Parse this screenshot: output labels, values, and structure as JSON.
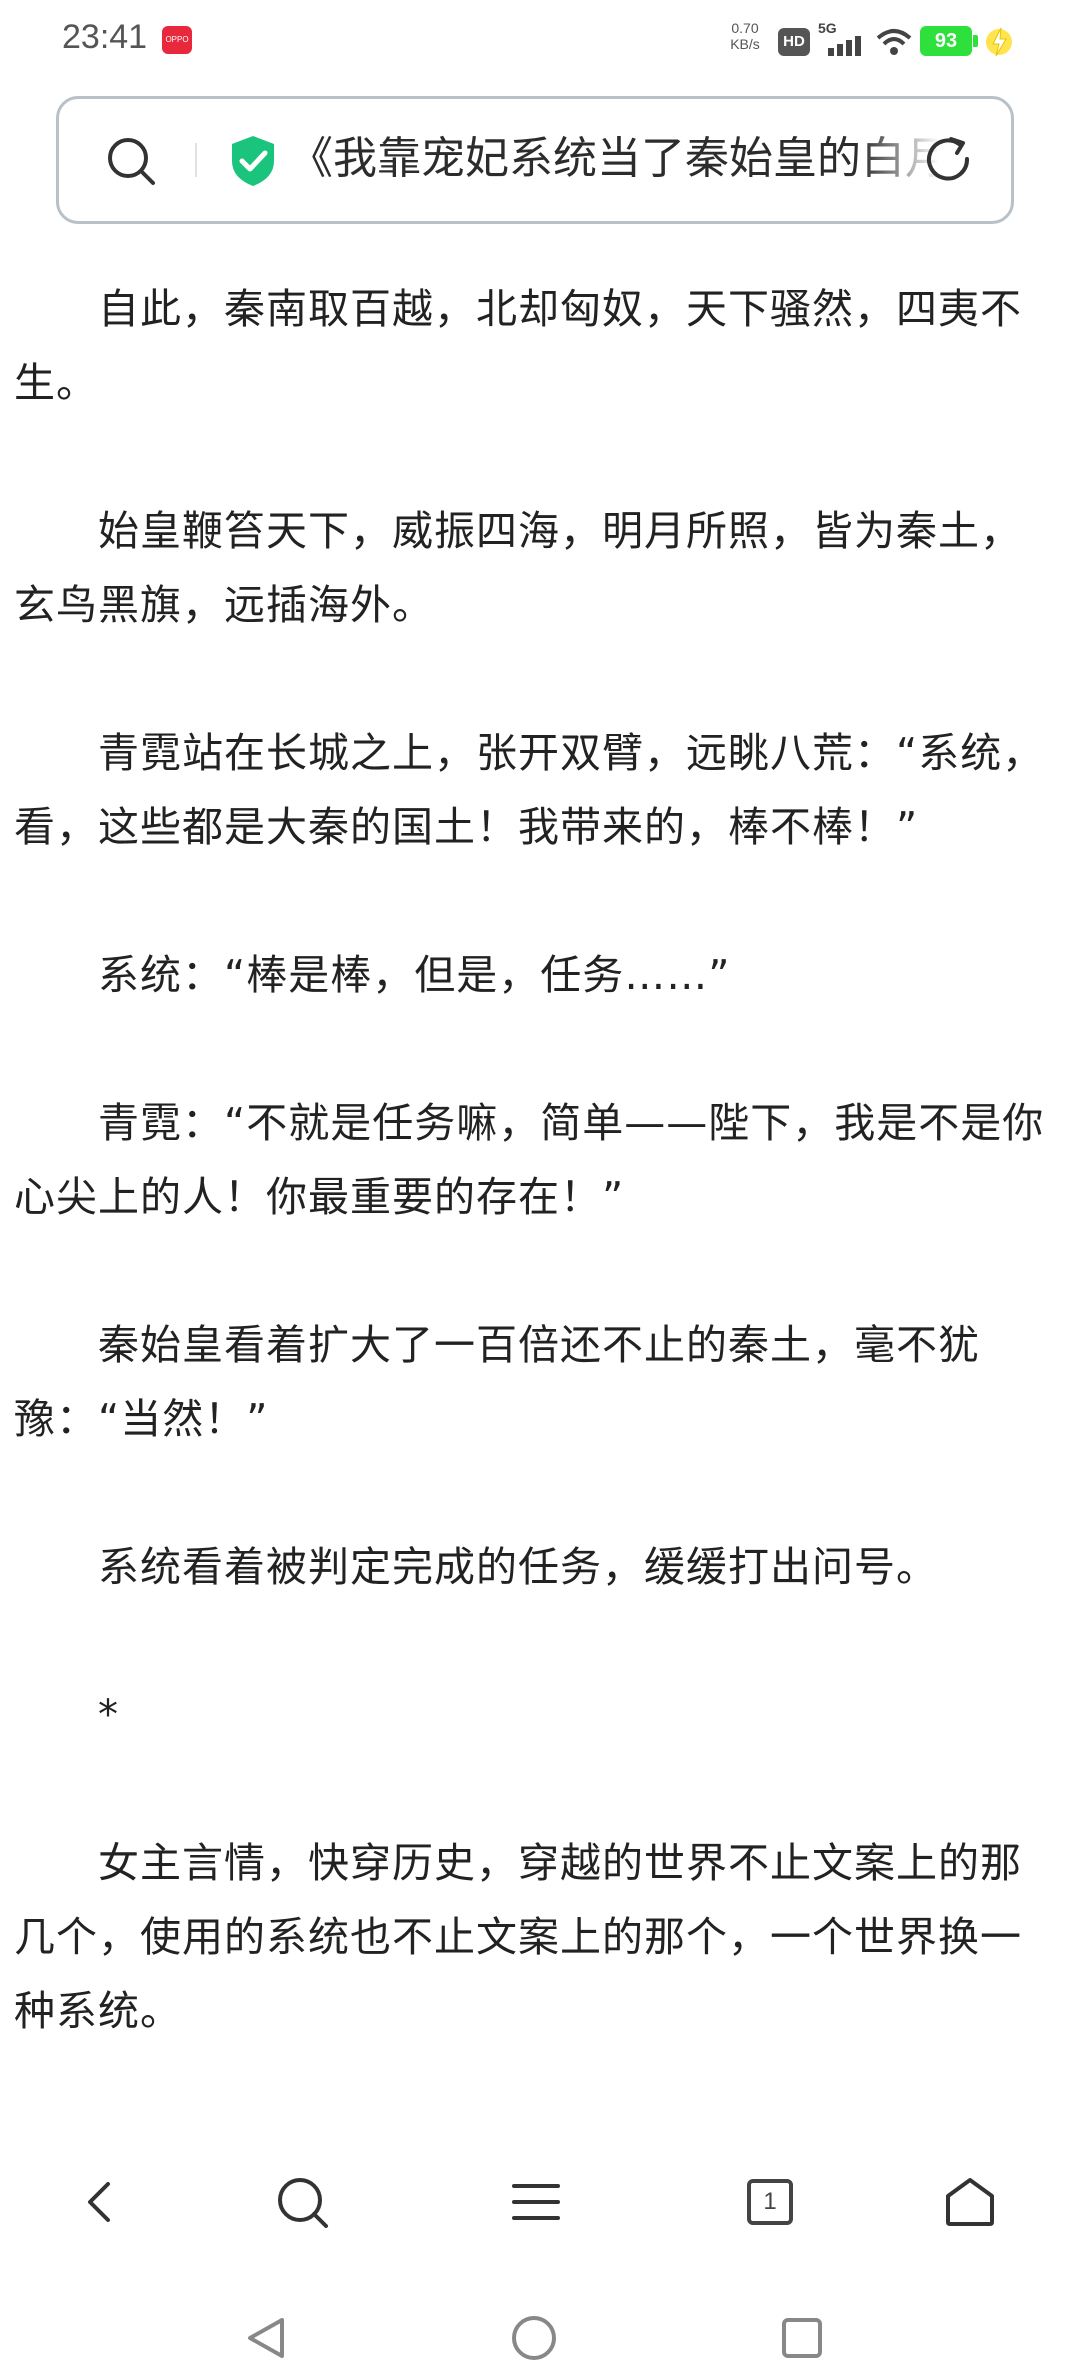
{
  "status_bar": {
    "time": "23:41",
    "notification_app_label": "OPPO",
    "net_speed_value": "0.70",
    "net_speed_unit": "KB/s",
    "hd_label": "HD",
    "signal_label": "5G",
    "battery_level": "93",
    "icons": [
      "notification-app-icon",
      "hd-icon",
      "signal-5g-icon",
      "wifi-icon",
      "battery-icon",
      "charging-icon"
    ]
  },
  "address_bar": {
    "title": "《我靠宠妃系统当了秦始皇的白月光》",
    "icons": [
      "search-icon",
      "shield-check-icon",
      "reload-icon"
    ],
    "accent": "#1bc47d"
  },
  "article": {
    "paragraphs": [
      "自此，秦南取百越，北却匈奴，天下骚然，四夷不生。",
      "始皇鞭笞天下，威振四海，明月所照，皆为秦土，玄鸟黑旗，远插海外。",
      "青霓站在长城之上，张开双臂，远眺八荒：“系统，看，这些都是大秦的国土！我带来的，棒不棒！”",
      "系统：“棒是棒，但是，任务……”",
      "青霓：“不就是任务嘛，简单——陛下，我是不是你心尖上的人！你最重要的存在！”",
      "秦始皇看着扩大了一百倍还不止的秦土，毫不犹豫：“当然！”",
      "系统看着被判定完成的任务，缓缓打出问号。",
      "*",
      "女主言情，快穿历史，穿越的世界不止文案上的那几个，使用的系统也不止文案上的那个，一个世界换一种系统。"
    ]
  },
  "toolbar": {
    "tab_count": "1",
    "buttons": [
      "back-icon",
      "search-icon",
      "menu-icon",
      "tabs-icon",
      "home-icon"
    ]
  },
  "system_nav": {
    "buttons": [
      "nav-back-icon",
      "nav-home-icon",
      "nav-recents-icon"
    ]
  }
}
